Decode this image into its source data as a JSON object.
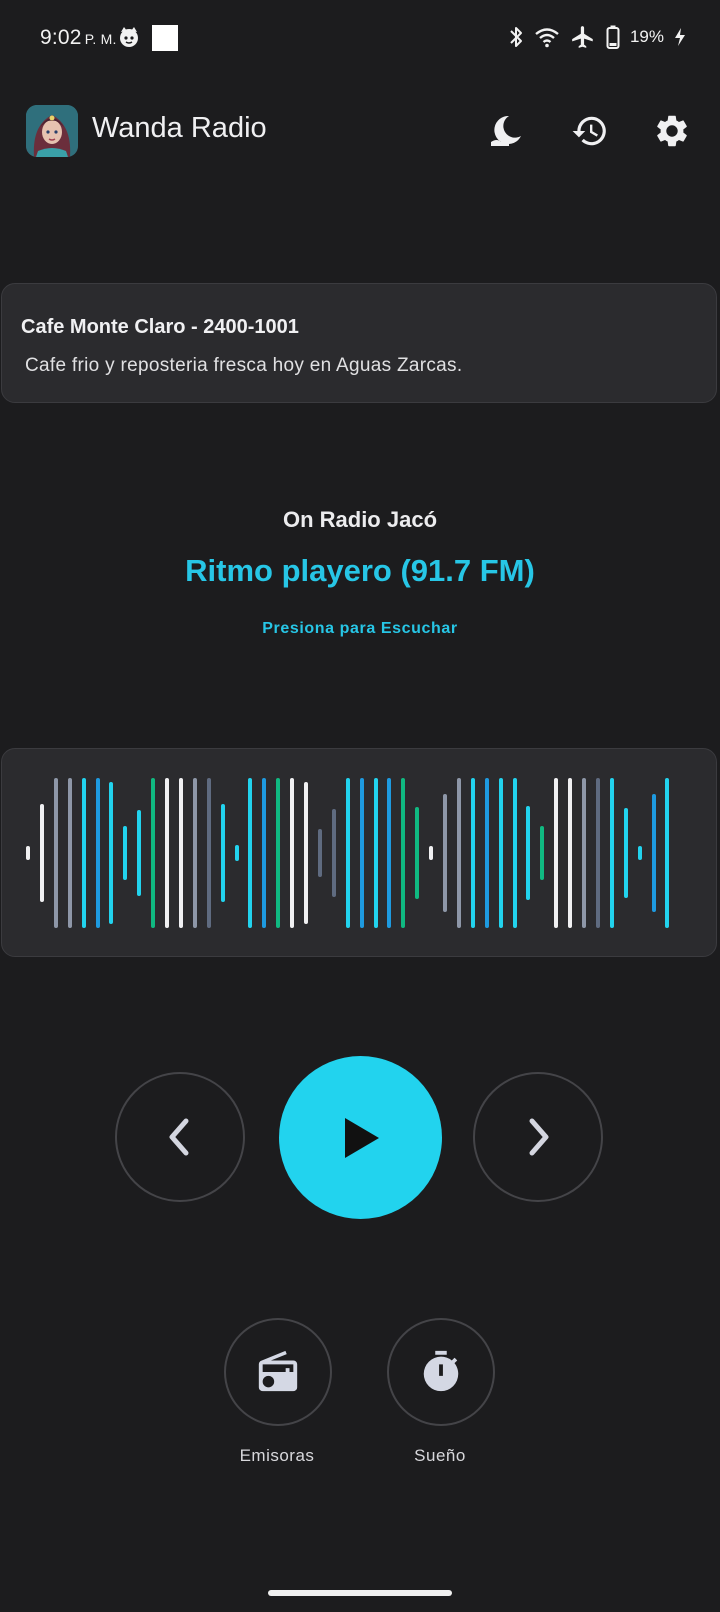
{
  "status_bar": {
    "time": "9:02",
    "ampm": "P. M.",
    "battery": "19%"
  },
  "header": {
    "app_title": "Wanda Radio",
    "icons": [
      "moon-icon",
      "history-icon",
      "gear-icon"
    ]
  },
  "ad": {
    "title": "Cafe Monte Claro - 2400-1001",
    "text": "Cafe frio y reposteria fresca hoy en Aguas Zarcas."
  },
  "now_playing": {
    "on_label": "On Radio Jacó",
    "station": "Ritmo playero (91.7 FM)",
    "action": "Presiona para Escuchar"
  },
  "colors": {
    "accent": "#22d3ee",
    "background": "#1c1c1e",
    "card": "#2b2b2e"
  },
  "controls": {
    "prev_icon": "chevron-left-icon",
    "play_icon": "play-icon",
    "next_icon": "chevron-right-icon"
  },
  "shortcuts": [
    {
      "label": "Emisoras",
      "icon": "radio-icon"
    },
    {
      "label": "Sueño",
      "icon": "timer-icon"
    }
  ]
}
